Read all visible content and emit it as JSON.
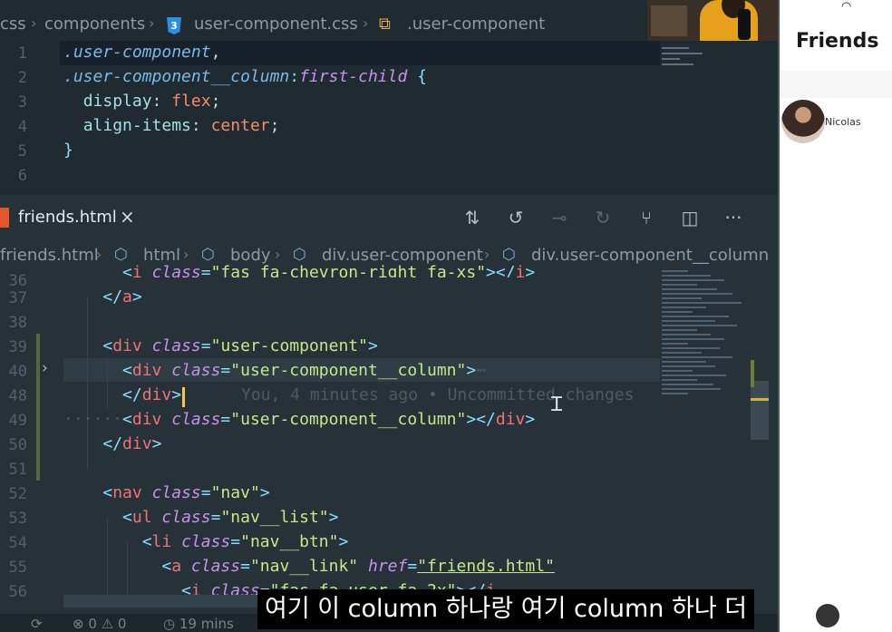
{
  "top_breadcrumb": {
    "seg0": "css",
    "seg1": "components",
    "seg2": "user-component.css",
    "seg3": ".user-component"
  },
  "top_code": [
    {
      "n": "1",
      "t": ".user-component,"
    },
    {
      "n": "2",
      "t": ".user-component__column:first-child {"
    },
    {
      "n": "3",
      "t": "  display: flex;"
    },
    {
      "n": "4",
      "t": "  align-items: center;"
    },
    {
      "n": "5",
      "t": "}"
    },
    {
      "n": "6",
      "t": ""
    }
  ],
  "tab": {
    "label": "friends.html",
    "close": "×"
  },
  "toolbar": {
    "compare": "⇅",
    "prev_change": "↺",
    "current_change": "⊸",
    "next_change": "↻",
    "git": "⑂",
    "split": "◫",
    "more": "···"
  },
  "bottom_breadcrumb": {
    "seg0": "friends.html",
    "seg1": "html",
    "seg2": "body",
    "seg3": "div.user-component",
    "seg4": "div.user-component__column"
  },
  "code_lines": {
    "l36": "36",
    "l37": "37",
    "l38": "38",
    "l39": "39",
    "l40": "40",
    "l48": "48",
    "l49": "49",
    "l50": "50",
    "l51": "51",
    "l52": "52",
    "l53": "53",
    "l54": "54",
    "l55": "55",
    "l56": "56"
  },
  "blame": "You, 4 minutes ago • Uncommitted changes",
  "statusbar": {
    "problems": "⊗ 0 ⚠ 0",
    "time": "◷ 19 mins"
  },
  "subtitle": "여기 이 column 하나랑 여기 column 하나 더",
  "preview": {
    "title": "Friends",
    "friend_name": "Nicolas"
  },
  "colors": {
    "editor_bg": "#263238",
    "tag": "#f07178",
    "attr": "#c792ea",
    "string": "#c3e88d",
    "cursor": "#f7c948"
  }
}
